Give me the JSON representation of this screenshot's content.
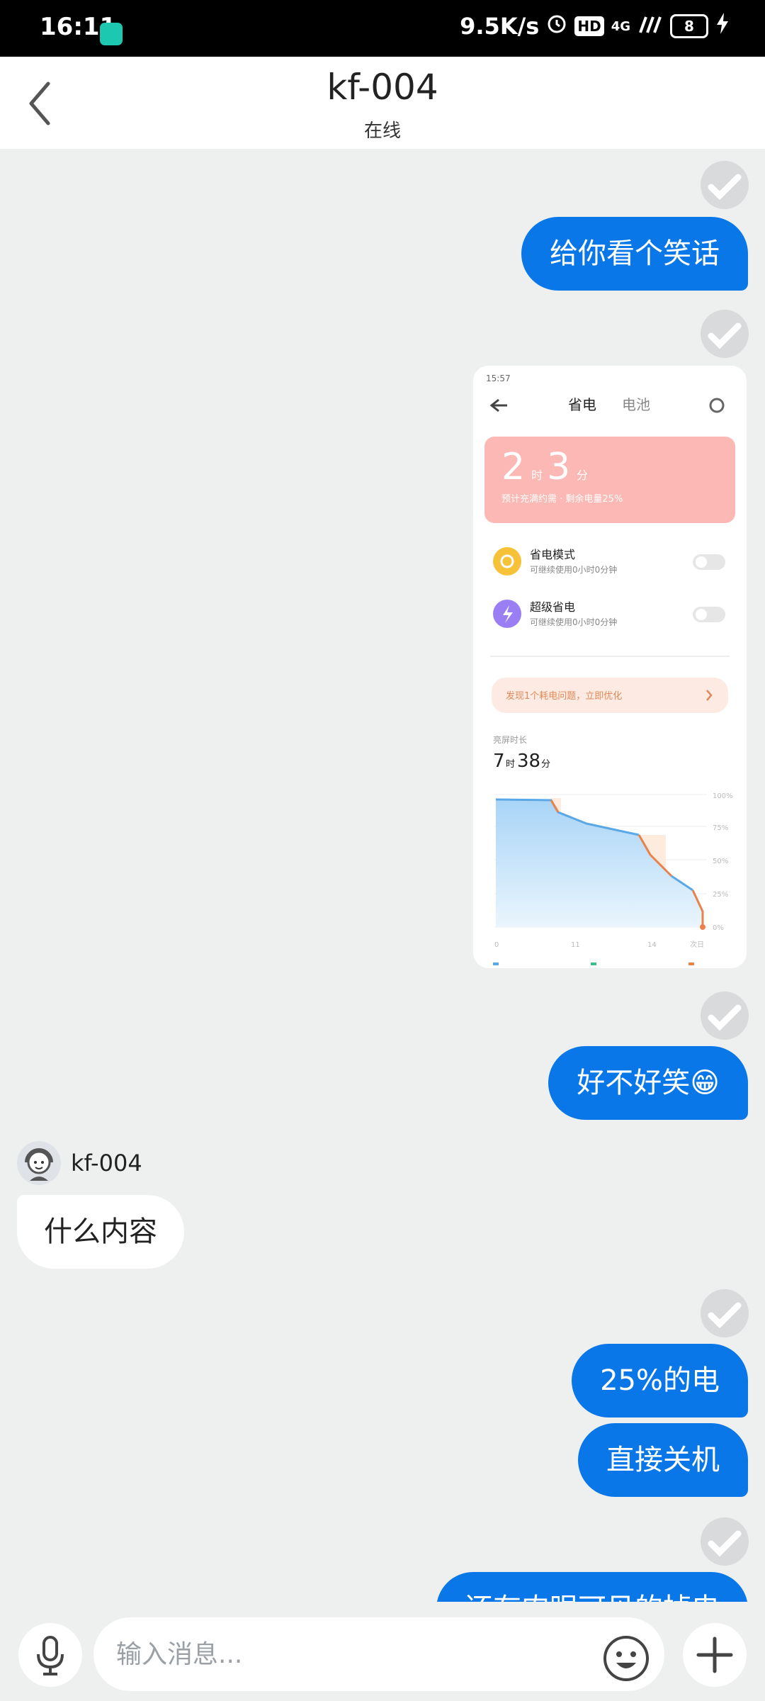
{
  "status_bar": {
    "time": "16:11",
    "net_speed": "9.5K/s",
    "hd_label": "HD",
    "signal_label": "4G",
    "battery": "8"
  },
  "header": {
    "title": "kf-004",
    "status": "在线"
  },
  "messages": [
    {
      "type": "out",
      "text": "给你看个笑话"
    },
    {
      "type": "out-image"
    },
    {
      "type": "out",
      "text": "好不好笑😁"
    },
    {
      "type": "in",
      "sender": "kf-004",
      "text": "什么内容"
    },
    {
      "type": "out",
      "text": "25%的电"
    },
    {
      "type": "out",
      "text": "直接关机"
    },
    {
      "type": "out",
      "text": "还有肉眼可见的掉电"
    }
  ],
  "screenshot": {
    "time": "15:57",
    "tab_active": "省电",
    "tab_other": "电池",
    "hours": "2",
    "hours_unit": "时",
    "minutes": "3",
    "minutes_unit": "分",
    "subtext": "预计充满约需 · 剩余电量25%",
    "option1_title": "省电模式",
    "option1_sub": "可继续使用0小时0分钟",
    "option2_title": "超级省电",
    "option2_sub": "可继续使用0小时0分钟",
    "tip": "发现1个耗电问题，立即优化",
    "usage_label": "亮屏时长",
    "usage_h": "7",
    "usage_m": "38",
    "y_labels": [
      "100%",
      "75%",
      "50%",
      "25%",
      "0%"
    ],
    "x_labels": [
      "0",
      "11",
      "14",
      "次日"
    ]
  },
  "input": {
    "placeholder": "输入消息..."
  },
  "colors": {
    "bubble_out": "#0a77e8",
    "bubble_in": "#ffffff",
    "background": "#eef0f0"
  },
  "icons": [
    "back-arrow-icon",
    "read-receipt-icon",
    "agent-avatar-icon",
    "microphone-icon",
    "emoji-icon",
    "plus-icon"
  ]
}
